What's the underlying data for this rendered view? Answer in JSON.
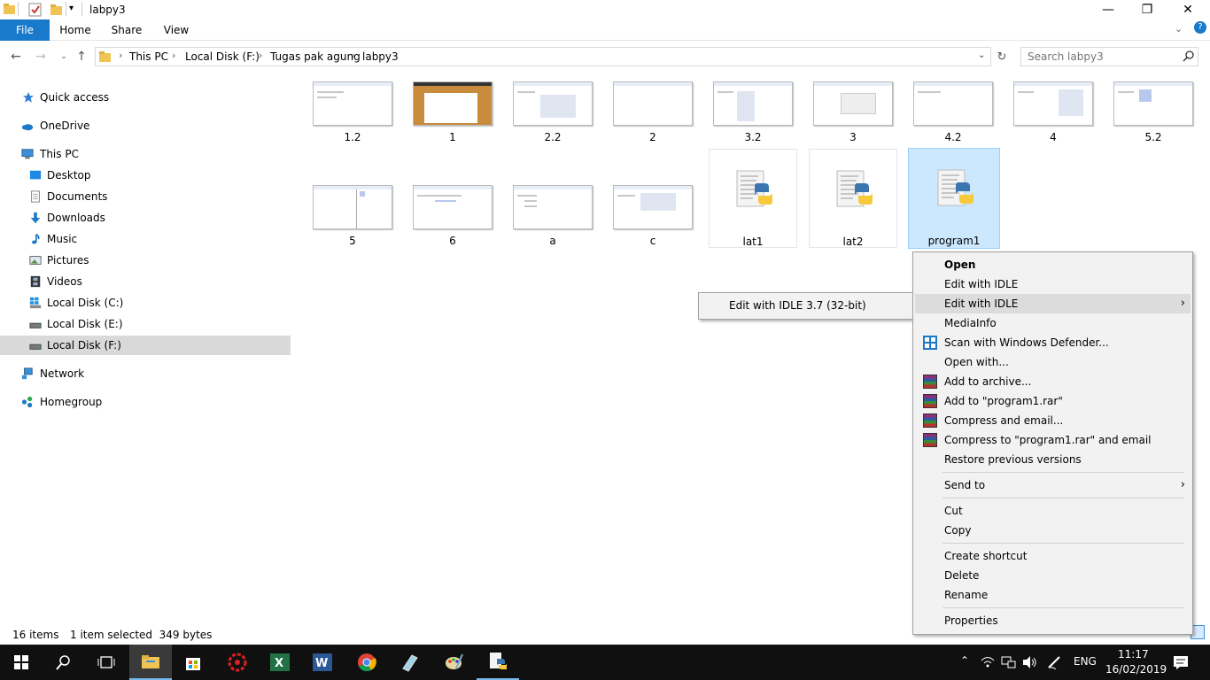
{
  "window": {
    "title": "labpy3",
    "controls": {
      "minimize": "—",
      "maximize": "❐",
      "close": "✕"
    }
  },
  "ribbon": {
    "tabs": [
      "File",
      "Home",
      "Share",
      "View"
    ]
  },
  "address": {
    "crumbs": [
      "This PC",
      "Local Disk (F:)",
      "Tugas pak agung",
      "labpy3"
    ],
    "search_placeholder": "Search labpy3"
  },
  "nav": {
    "quick_access": "Quick access",
    "onedrive": "OneDrive",
    "this_pc": "This PC",
    "desktop": "Desktop",
    "documents": "Documents",
    "downloads": "Downloads",
    "music": "Music",
    "pictures": "Pictures",
    "videos": "Videos",
    "disk_c": "Local Disk (C:)",
    "disk_e": "Local Disk (E:)",
    "disk_f": "Local Disk (F:)",
    "network": "Network",
    "homegroup": "Homegroup"
  },
  "files": {
    "row1": [
      "1.2",
      "1",
      "2.2",
      "2",
      "3.2",
      "3",
      "4.2",
      "4",
      "5.2"
    ],
    "row2": [
      "5",
      "6",
      "a",
      "c"
    ],
    "py": [
      "lat1",
      "lat2",
      "program1"
    ]
  },
  "context_menu": {
    "open": "Open",
    "edit_idle_1": "Edit with IDLE",
    "edit_idle_2": "Edit with IDLE",
    "mediainfo": "MediaInfo",
    "defender": "Scan with Windows Defender...",
    "open_with": "Open with...",
    "add_archive": "Add to archive...",
    "add_rar": "Add to \"program1.rar\"",
    "compress_email": "Compress and email...",
    "compress_rar_email": "Compress to \"program1.rar\" and email",
    "restore": "Restore previous versions",
    "send_to": "Send to",
    "cut": "Cut",
    "copy": "Copy",
    "create_shortcut": "Create shortcut",
    "delete": "Delete",
    "rename": "Rename",
    "properties": "Properties"
  },
  "submenu": {
    "item": "Edit with IDLE 3.7 (32-bit)"
  },
  "status": {
    "count": "16 items",
    "selection": "1 item selected  349 bytes"
  },
  "taskbar": {
    "lang": "ENG",
    "time": "11:17",
    "date": "16/02/2019"
  },
  "colors": {
    "accent": "#1979ca",
    "selection": "#cce8ff",
    "taskbar": "#101010"
  }
}
